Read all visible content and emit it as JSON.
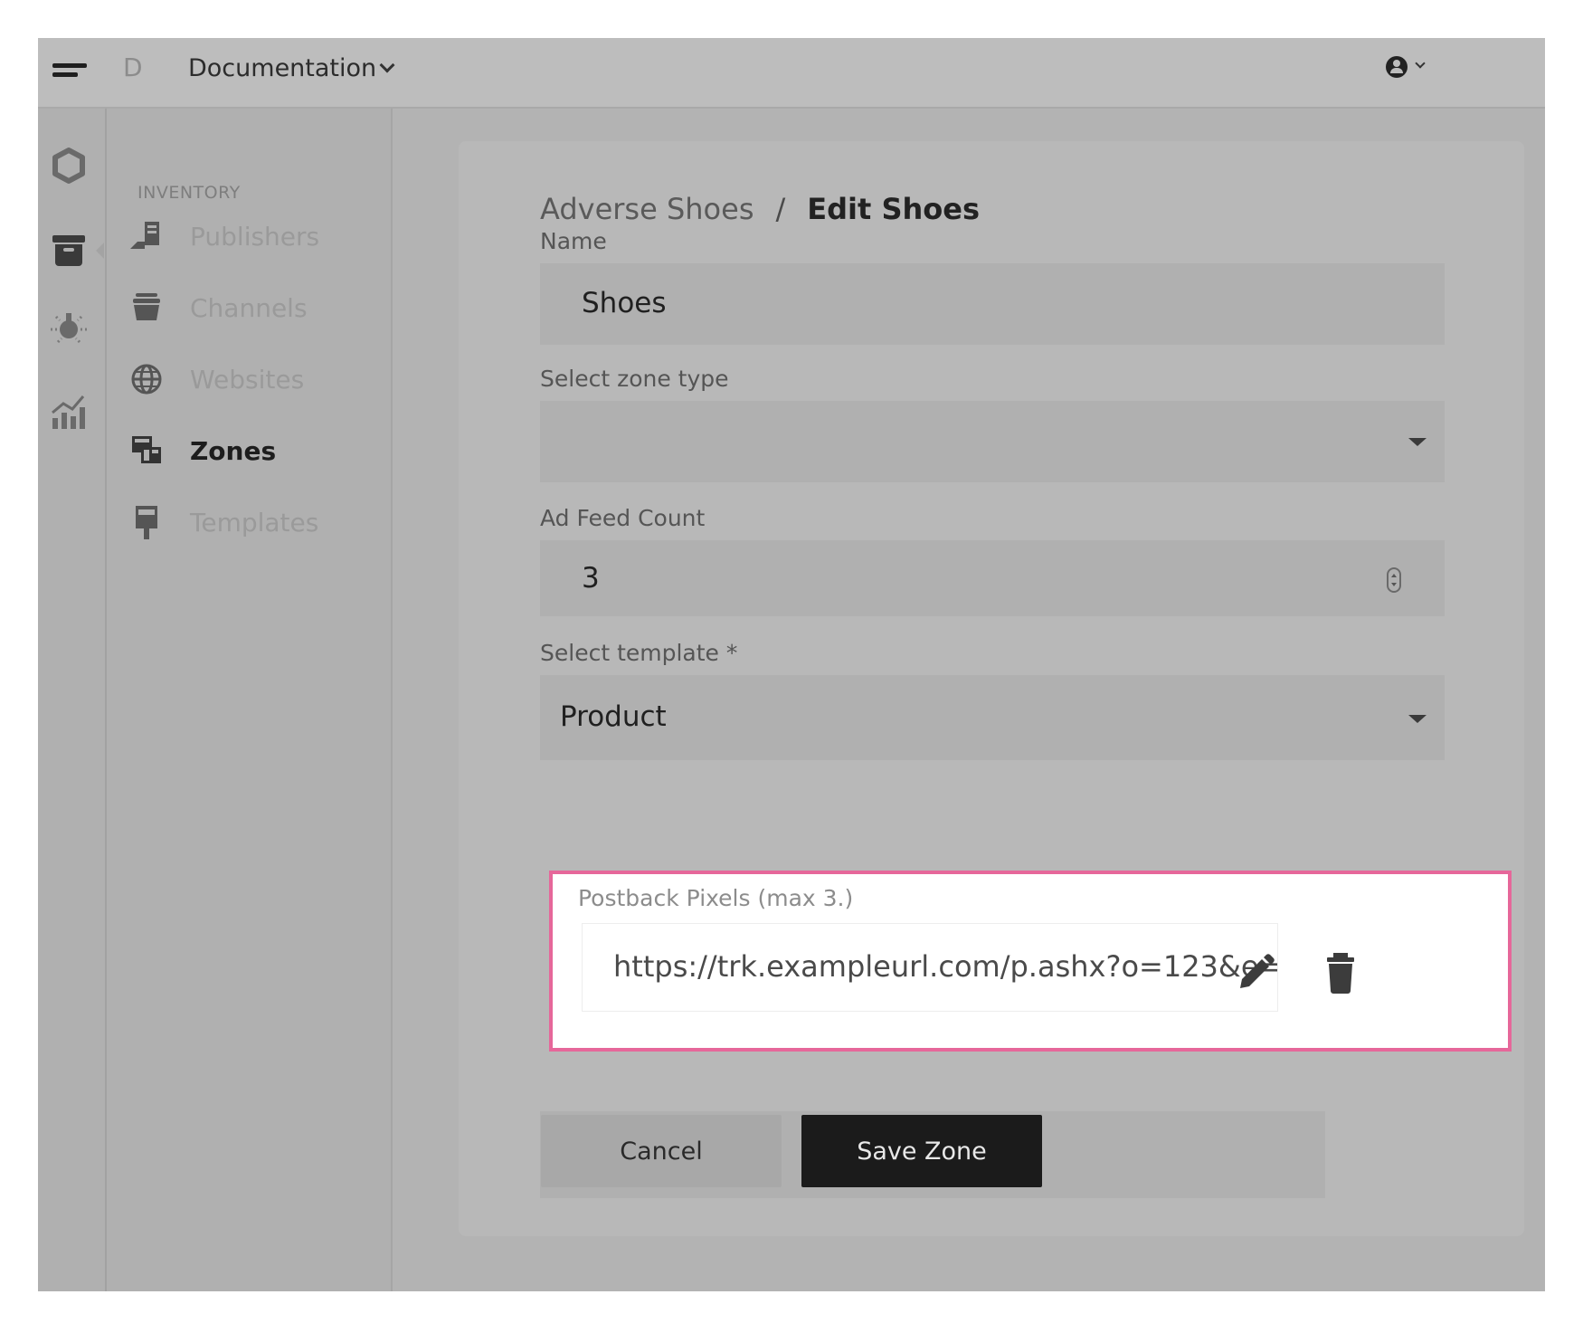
{
  "topbar": {
    "brand_letter": "D",
    "project_label": "Documentation"
  },
  "sidebar": {
    "section_title": "INVENTORY",
    "items": [
      {
        "label": "Publishers",
        "icon": "publishers-icon",
        "active": false
      },
      {
        "label": "Channels",
        "icon": "channels-icon",
        "active": false
      },
      {
        "label": "Websites",
        "icon": "globe-icon",
        "active": false
      },
      {
        "label": "Zones",
        "icon": "zones-icon",
        "active": true
      },
      {
        "label": "Templates",
        "icon": "templates-icon",
        "active": false
      }
    ]
  },
  "rail": {
    "icons": [
      "hub-icon",
      "inventory-box-icon",
      "lightbulb-icon",
      "analytics-chart-icon"
    ],
    "active_index": 1
  },
  "breadcrumb": {
    "parent": "Adverse Shoes",
    "separator": "/",
    "current": "Edit Shoes"
  },
  "form": {
    "name_label": "Name",
    "name_value": "Shoes",
    "zone_type_label": "Select zone type",
    "zone_type_value": "",
    "ad_feed_label": "Ad Feed Count",
    "ad_feed_value": "3",
    "template_label": "Select template *",
    "template_value": "Product",
    "postback_label": "Postback Pixels (max 3.)",
    "postback_url": "https://trk.exampleurl.com/p.ashx?o=123&e="
  },
  "buttons": {
    "cancel": "Cancel",
    "save": "Save Zone"
  },
  "colors": {
    "highlight_border": "#e6679a",
    "save_button_bg": "#1b1b1b"
  }
}
